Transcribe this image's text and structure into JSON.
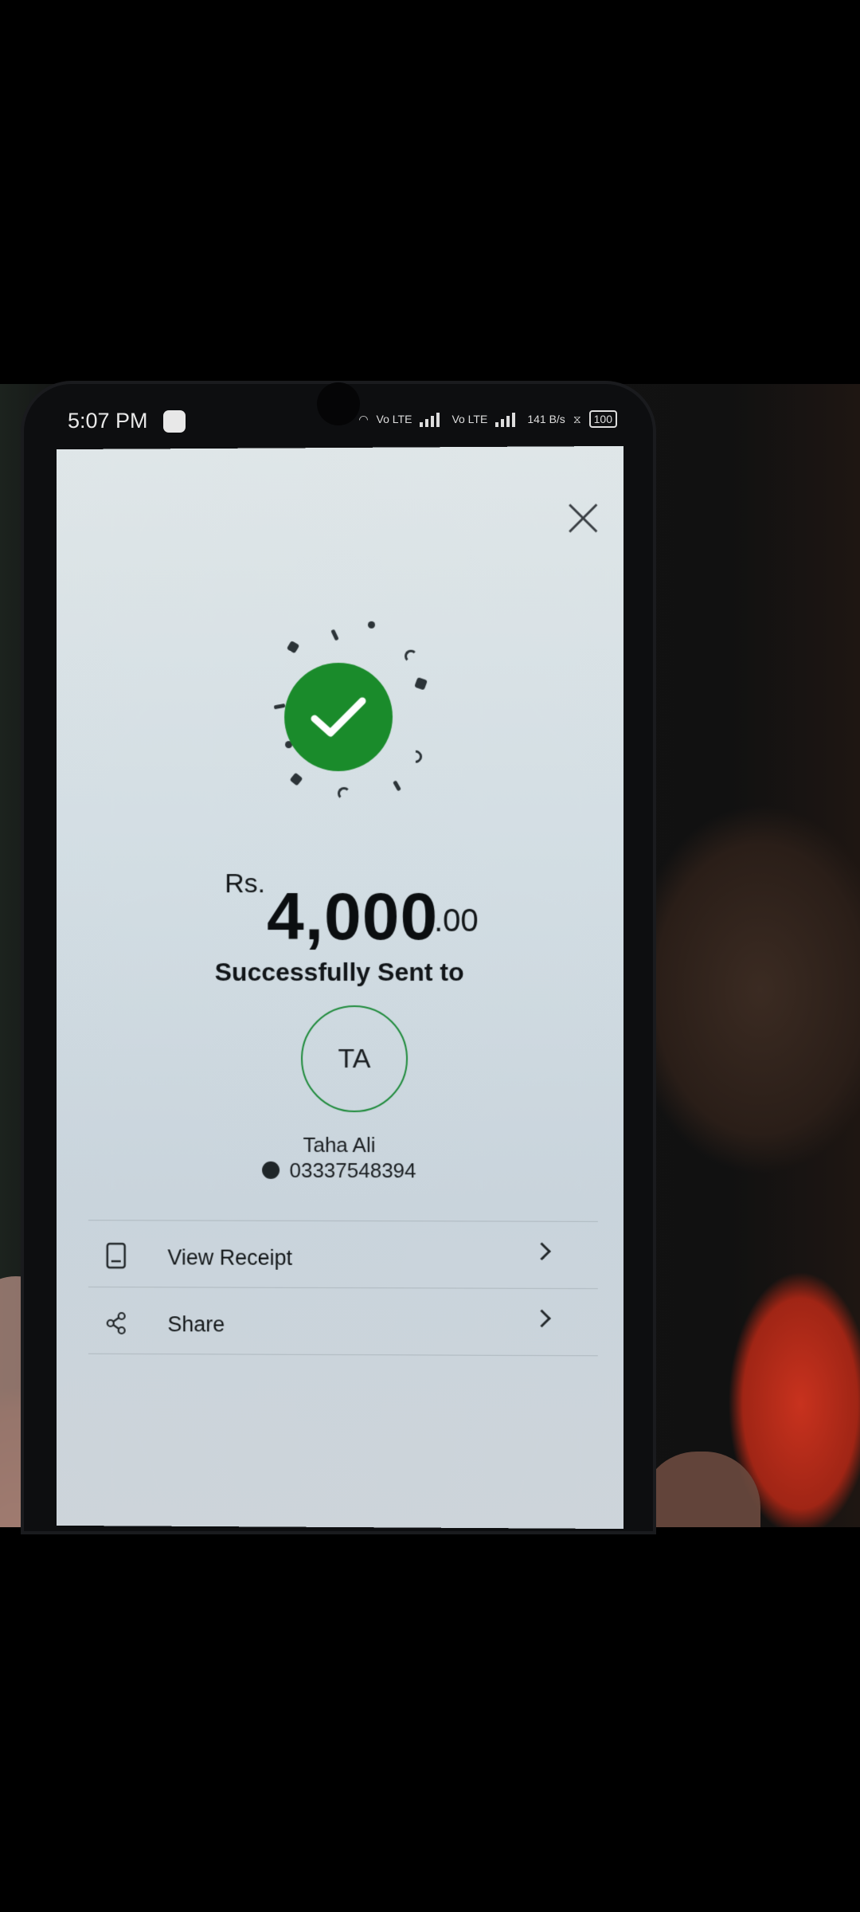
{
  "status_bar": {
    "time": "5:07 PM",
    "network_1": "Vo LTE",
    "network_2": "Vo LTE",
    "speed": "141 B/s",
    "battery": "100"
  },
  "icons": {
    "close": "close-icon",
    "success": "checkmark-icon",
    "wallet": "wallet-icon",
    "receipt": "receipt-icon",
    "share": "share-icon",
    "chevron": "chevron-right-icon"
  },
  "colors": {
    "success_green": "#1a8b2b",
    "avatar_border": "#1d8a3a"
  },
  "transfer": {
    "currency": "Rs.",
    "amount_main": "4,000",
    "amount_decimal": ".00",
    "status_text": "Successfully Sent to"
  },
  "recipient": {
    "initials": "TA",
    "name": "Taha Ali",
    "phone": "03337548394"
  },
  "actions": [
    {
      "label": "View Receipt"
    },
    {
      "label": "Share"
    }
  ]
}
